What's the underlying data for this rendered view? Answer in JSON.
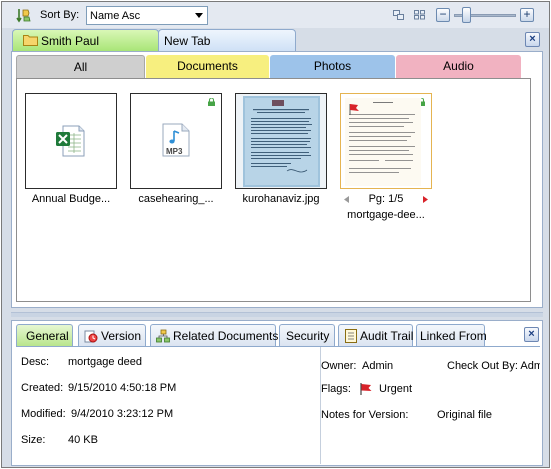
{
  "toolbar": {
    "sort_label": "Sort By:",
    "sort_value": "Name Asc",
    "zoom_minus": "−",
    "zoom_plus": "+",
    "zoom_level": 0.15
  },
  "tabs": [
    {
      "label": "Smith Paul",
      "active": true
    },
    {
      "label": "New Tab",
      "active": false
    }
  ],
  "close_glyph": "×",
  "categories": [
    {
      "label": "All",
      "color": "#cfcfcf"
    },
    {
      "label": "Documents",
      "color": "#f7ef7f"
    },
    {
      "label": "Photos",
      "color": "#9dc3ea"
    },
    {
      "label": "Audio",
      "color": "#f1b2c1"
    }
  ],
  "files": [
    {
      "caption": "Annual Budge...",
      "type": "excel-icon"
    },
    {
      "caption": "casehearing_...",
      "type": "mp3-icon",
      "badge": "MP3"
    },
    {
      "caption": "kurohanaviz.jpg",
      "type": "photo-thumbnail"
    },
    {
      "caption": "mortgage-dee...",
      "type": "document-thumbnail",
      "page": "Pg: 1/5"
    }
  ],
  "properties": {
    "tabs": [
      "General",
      "Version",
      "Related Documents",
      "Security",
      "Audit Trail",
      "Linked From"
    ],
    "desc_label": "Desc:",
    "desc_value": "mortgage deed",
    "created_label": "Created:",
    "created_value": "9/15/2010 4:50:18 PM",
    "modified_label": "Modified:",
    "modified_value": "9/4/2010 3:23:12 PM",
    "size_label": "Size:",
    "size_value": "40 KB",
    "owner_label": "Owner:",
    "owner_value": "Admin",
    "checkout_label": "Check Out By:",
    "checkout_value": "Admin",
    "flags_label": "Flags:",
    "flags_value": "Urgent",
    "notes_label": "Notes for Version:",
    "notes_value": "Original file"
  }
}
